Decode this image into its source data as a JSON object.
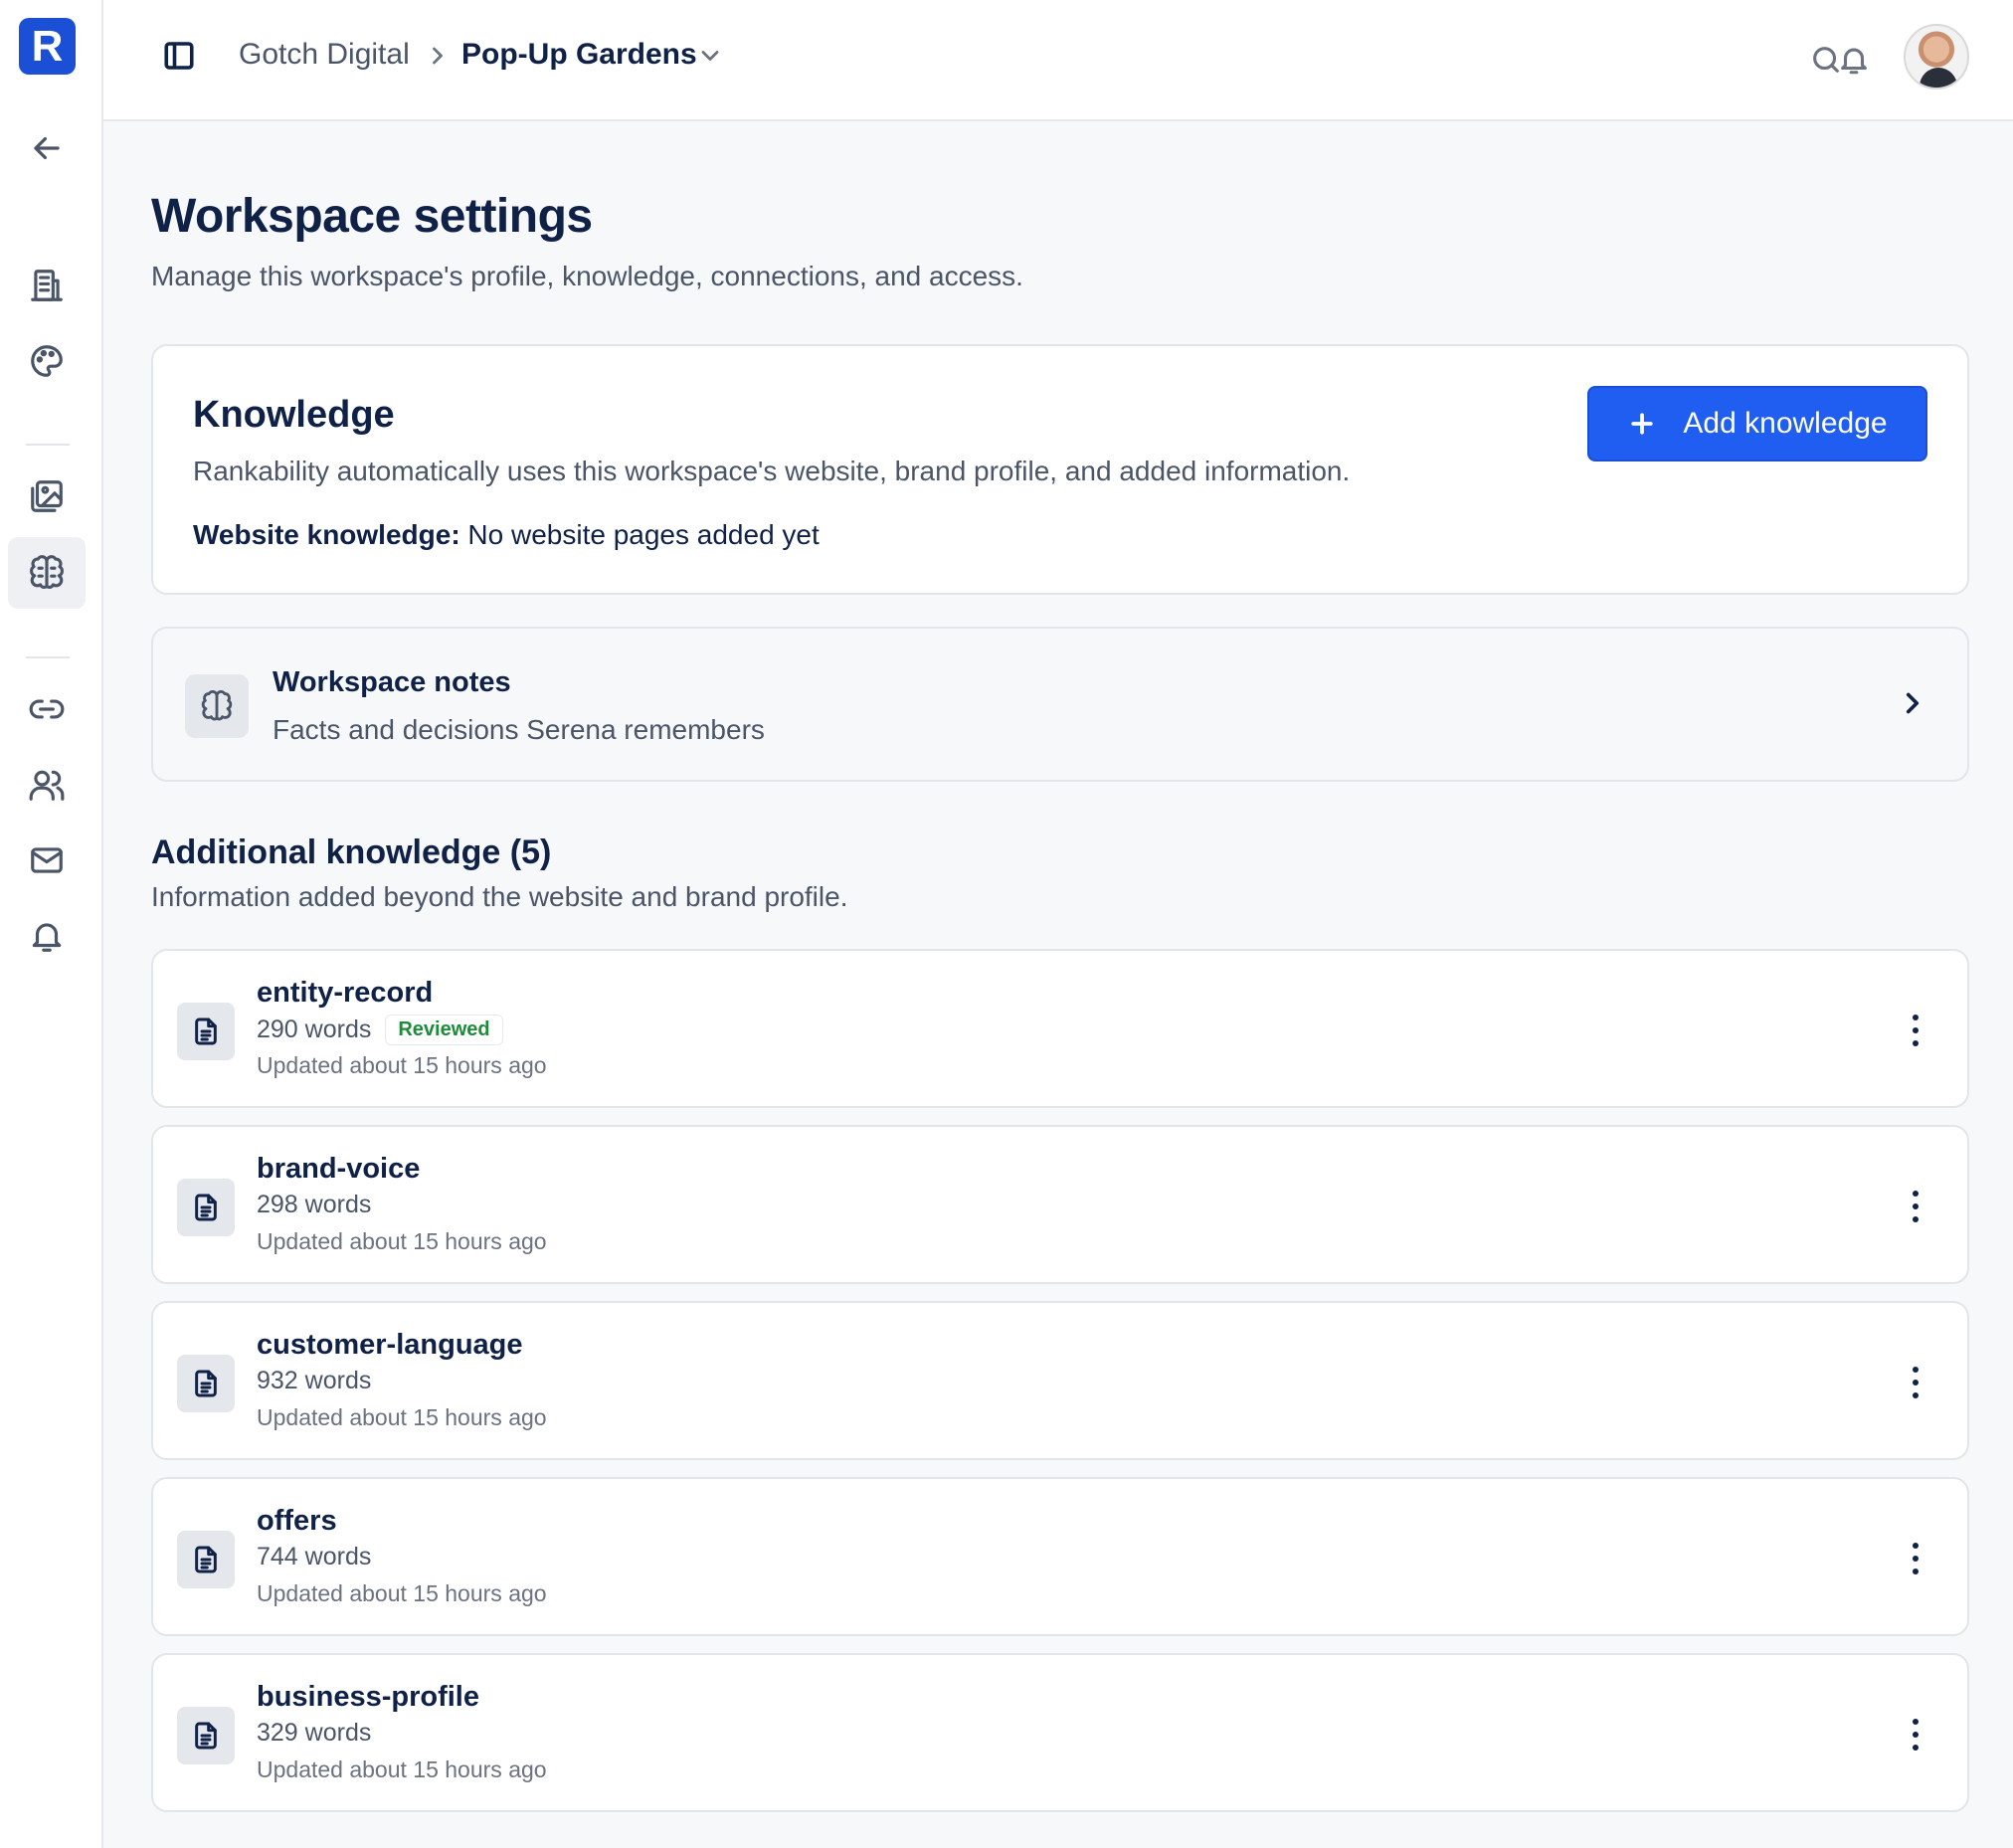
{
  "sidebar": {
    "logo": "R",
    "items": [
      {
        "icon": "arrow-left-icon",
        "name": "back"
      },
      {
        "icon": "building-icon",
        "name": "workspace"
      },
      {
        "icon": "palette-icon",
        "name": "brand"
      },
      {
        "icon": "image-gallery-icon",
        "name": "media"
      },
      {
        "icon": "brain-icon",
        "name": "knowledge",
        "active": true
      },
      {
        "icon": "link-icon",
        "name": "connections"
      },
      {
        "icon": "users-icon",
        "name": "members"
      },
      {
        "icon": "mail-icon",
        "name": "email"
      },
      {
        "icon": "bell-icon",
        "name": "notifications"
      }
    ]
  },
  "topbar": {
    "org": "Gotch Digital",
    "workspace": "Pop-Up Gardens"
  },
  "page": {
    "title": "Workspace settings",
    "subtitle": "Manage this workspace's profile, knowledge, connections, and access."
  },
  "knowledge": {
    "title": "Knowledge",
    "description": "Rankability automatically uses this workspace's website, brand profile, and added information.",
    "website_label": "Website knowledge:",
    "website_value": "No website pages added yet",
    "add_button": "Add knowledge"
  },
  "notes": {
    "title": "Workspace notes",
    "subtitle": "Facts and decisions Serena remembers"
  },
  "additional": {
    "title": "Additional knowledge (5)",
    "subtitle": "Information added beyond the website and brand profile.",
    "items": [
      {
        "name": "entity-record",
        "words": "290 words",
        "badge": "Reviewed",
        "updated": "Updated about 15 hours ago"
      },
      {
        "name": "brand-voice",
        "words": "298 words",
        "badge": "",
        "updated": "Updated about 15 hours ago"
      },
      {
        "name": "customer-language",
        "words": "932 words",
        "badge": "",
        "updated": "Updated about 15 hours ago"
      },
      {
        "name": "offers",
        "words": "744 words",
        "badge": "",
        "updated": "Updated about 15 hours ago"
      },
      {
        "name": "business-profile",
        "words": "329 words",
        "badge": "",
        "updated": "Updated about 15 hours ago"
      }
    ]
  },
  "colors": {
    "primary": "#1f5ef0",
    "heading": "#0f2147",
    "success": "#1f8a3a"
  }
}
